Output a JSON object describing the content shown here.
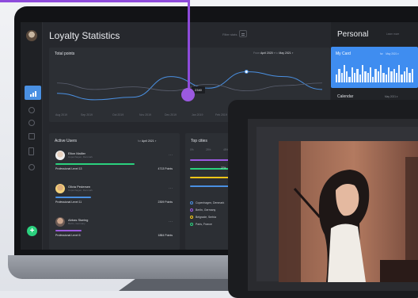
{
  "app": {
    "title": "Loyalty Statistics",
    "filter_label": "Filter stats"
  },
  "chart": {
    "title": "Total points",
    "range_from_label": "From",
    "range_from": "April 2020",
    "range_to_label": "to",
    "range_to": "May 2021",
    "tooltip": "2340",
    "x_labels": [
      "Aug 2019",
      "Sep 2019",
      "Oct 2019",
      "Nov 2019",
      "Dec 2019",
      "Jan 2019",
      "Feb 2019"
    ]
  },
  "chart_data": {
    "type": "line",
    "title": "Total points",
    "categories": [
      "Aug 2019",
      "Sep 2019",
      "Oct 2019",
      "Nov 2019",
      "Dec 2019",
      "Jan 2019",
      "Feb 2019"
    ],
    "series": [
      {
        "values": [
          1500,
          1250,
          1350,
          2150,
          1700,
          2340,
          2150,
          1650
        ]
      },
      {
        "values": [
          1900,
          1650,
          1750,
          1600,
          1850,
          1600,
          1800,
          1900
        ]
      }
    ],
    "grid": false
  },
  "users": {
    "title": "Active Users",
    "period_label": "for",
    "period": "April 2021",
    "list": [
      {
        "name": "Elton Mailler",
        "location": "Copenhagen, Denmark",
        "level": "Professional Level 13",
        "points": "4713 Points",
        "progress": 0.85,
        "color": "#2bd17e"
      },
      {
        "name": "Olivia Pedersen",
        "location": "Copenhagen, Denmark",
        "level": "Professional Level 11",
        "points": "2309 Points",
        "progress": 0.38,
        "color": "#4a90e2"
      },
      {
        "name": "Abbas Støring",
        "location": "Berlin, Germany",
        "level": "Professional Level 6",
        "points": "1884 Points",
        "progress": 0.28,
        "color": "#9b59e0"
      }
    ]
  },
  "cities": {
    "title": "Top cities",
    "scale": [
      "0%",
      "25%",
      "45%"
    ],
    "bars": [
      {
        "color": "#9b59e0",
        "pct": "",
        "fill": 0.9
      },
      {
        "color": "#2bd17e",
        "pct": "27%",
        "fill": 0.55
      },
      {
        "color": "#f5c518",
        "pct": "5",
        "fill": 0.72
      },
      {
        "color": "#4a90e2",
        "pct": "",
        "fill": 0.9
      }
    ],
    "list": [
      {
        "name": "Copenhagen, Denmark",
        "color": "#4a90e2"
      },
      {
        "name": "Berlin, Germany",
        "color": "#9b59e0"
      },
      {
        "name": "Belgrade, Serbia",
        "color": "#f5c518"
      },
      {
        "name": "Paris, France",
        "color": "#2bd17e"
      }
    ]
  },
  "personal": {
    "title": "Personal",
    "link": "Learn more",
    "card_title": "My Card",
    "card_for": "for",
    "card_period": "May 2021",
    "calendar_title": "Calendar",
    "calendar_period": "May 2021"
  },
  "nav": {
    "add_label": "+"
  }
}
